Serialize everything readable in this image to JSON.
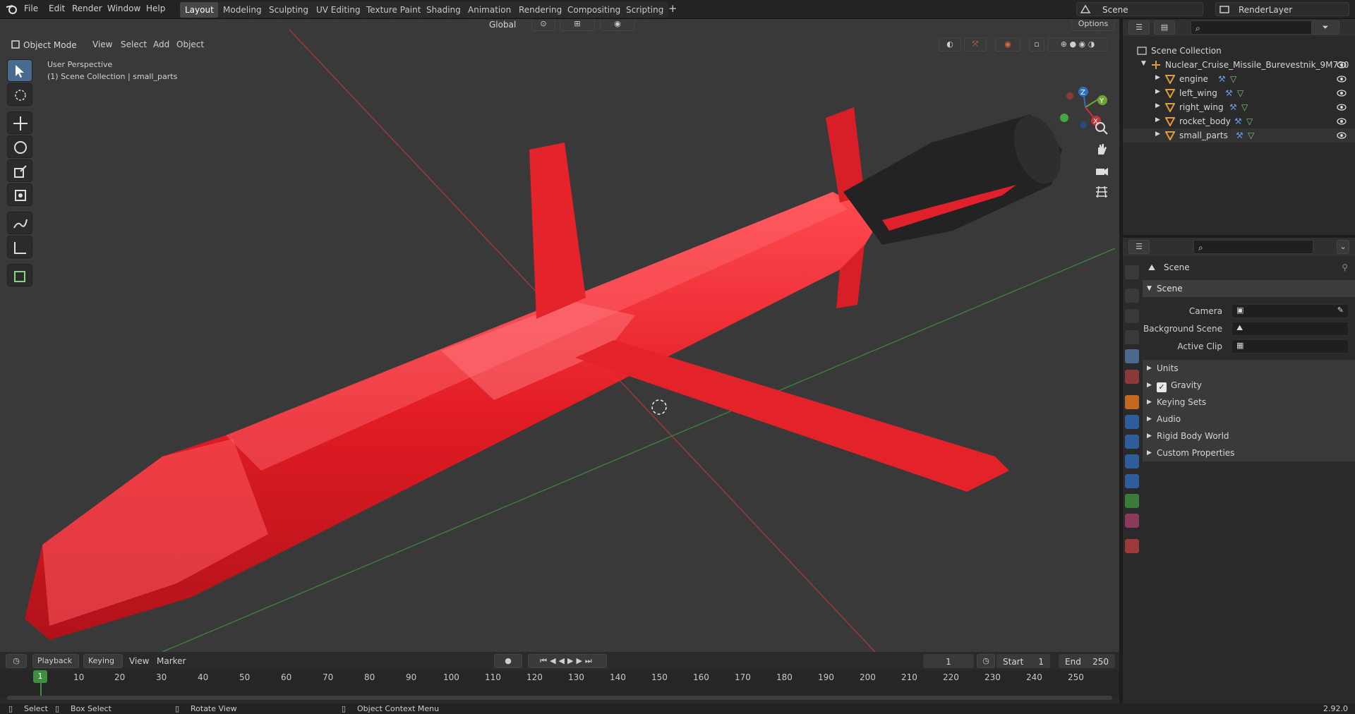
{
  "app": {
    "name": "Blender",
    "version": "2.92.0"
  },
  "topbar": {
    "menus": [
      "File",
      "Edit",
      "Render",
      "Window",
      "Help"
    ],
    "workspaces": [
      "Layout",
      "Modeling",
      "Sculpting",
      "UV Editing",
      "Texture Paint",
      "Shading",
      "Animation",
      "Rendering",
      "Compositing",
      "Scripting"
    ],
    "active_workspace": "Layout",
    "add_tab": "+",
    "scene": "Scene",
    "view_layer": "RenderLayer"
  },
  "viewport": {
    "mode": "Object Mode",
    "menus": [
      "View",
      "Select",
      "Add",
      "Object"
    ],
    "orientation": "Global",
    "options": "Options",
    "overlay_line1": "User Perspective",
    "overlay_line2": "(1) Scene Collection | small_parts",
    "gizmo": {
      "x": "X",
      "y": "Y",
      "z": "Z"
    }
  },
  "outliner": {
    "root": "Scene Collection",
    "collection": "Nuclear_Cruise_Missile_Burevestnik_9M730",
    "objects": [
      "engine",
      "left_wing",
      "right_wing",
      "rocket_body",
      "small_parts"
    ]
  },
  "properties": {
    "context": "Scene",
    "panel": "Scene",
    "fields": [
      {
        "label": "Camera",
        "value": ""
      },
      {
        "label": "Background Scene",
        "value": ""
      },
      {
        "label": "Active Clip",
        "value": ""
      }
    ],
    "subpanels": [
      "Units",
      "Gravity",
      "Keying Sets",
      "Audio",
      "Rigid Body World",
      "Custom Properties"
    ],
    "gravity_checked": true
  },
  "timeline": {
    "menus": [
      "Playback",
      "Keying",
      "View",
      "Marker"
    ],
    "current_frame": "1",
    "start_label": "Start",
    "start": "1",
    "end_label": "End",
    "end": "250",
    "ruler": [
      "1",
      "10",
      "20",
      "30",
      "40",
      "50",
      "60",
      "70",
      "80",
      "90",
      "100",
      "110",
      "120",
      "130",
      "140",
      "150",
      "160",
      "170",
      "180",
      "190",
      "200",
      "210",
      "220",
      "230",
      "240",
      "250"
    ]
  },
  "statusbar": {
    "items": [
      "Select",
      "Box Select",
      "Rotate View",
      "Object Context Menu"
    ],
    "version": "2.92.0"
  },
  "colors": {
    "accent": "#4a6b8f",
    "missile": "#e8232a",
    "grid": "#393939",
    "panel": "#2a2a2a"
  }
}
